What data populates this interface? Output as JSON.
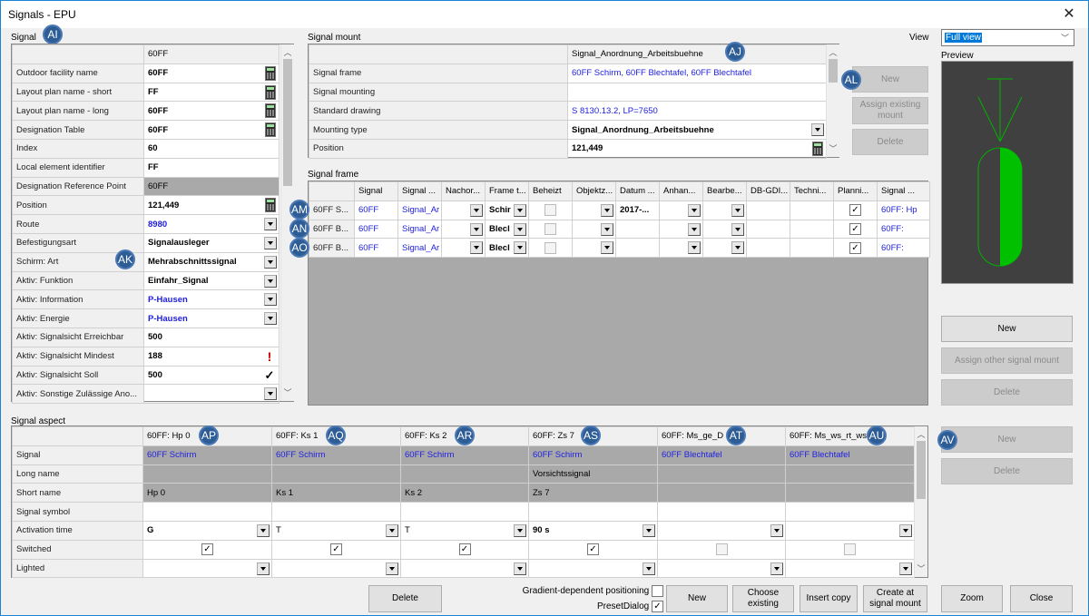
{
  "window": {
    "title": "Signals - EPU",
    "close_label": "✕"
  },
  "signal": {
    "section_label": "Signal",
    "column_header": "60FF",
    "rows": [
      {
        "label": "Outdoor facility name",
        "value": "60FF",
        "style": "bold",
        "control": "calc"
      },
      {
        "label": "Layout plan name - short",
        "value": "FF",
        "style": "bold",
        "control": "calc"
      },
      {
        "label": "Layout plan name - long",
        "value": "60FF",
        "style": "bold",
        "control": "calc"
      },
      {
        "label": "Designation Table",
        "value": "60FF",
        "style": "bold",
        "control": "calc"
      },
      {
        "label": "Index",
        "value": "60",
        "style": "bold",
        "control": ""
      },
      {
        "label": "Local element identifier",
        "value": "FF",
        "style": "bold",
        "control": ""
      },
      {
        "label": "Designation Reference Point",
        "value": "60FF",
        "style": "gray",
        "control": ""
      },
      {
        "label": "Position",
        "value": "121,449",
        "style": "bold",
        "control": "calc"
      },
      {
        "label": "Route",
        "value": "8980",
        "style": "blue",
        "control": "dropdown"
      },
      {
        "label": "Befestigungsart",
        "value": "Signalausleger",
        "style": "bold",
        "control": "dropdown"
      },
      {
        "label": "Schirm: Art",
        "value": "Mehrabschnittssignal",
        "style": "bold",
        "control": "dropdown"
      },
      {
        "label": "Aktiv: Funktion",
        "value": "Einfahr_Signal",
        "style": "bold",
        "control": "dropdown"
      },
      {
        "label": "Aktiv: Information",
        "value": "P-Hausen",
        "style": "blue",
        "control": "dropdown"
      },
      {
        "label": "Aktiv: Energie",
        "value": "P-Hausen",
        "style": "blue",
        "control": "dropdown"
      },
      {
        "label": "Aktiv: Signalsicht Erreichbar",
        "value": "500",
        "style": "bold",
        "control": ""
      },
      {
        "label": "Aktiv: Signalsicht Mindest",
        "value": "188",
        "style": "bold",
        "control": "warning"
      },
      {
        "label": "Aktiv: Signalsicht Soll",
        "value": "500",
        "style": "bold",
        "control": "check"
      },
      {
        "label": "Aktiv: Sonstige Zulässige Ano...",
        "value": "",
        "style": "bold",
        "control": "dropdown"
      }
    ]
  },
  "signal_mount": {
    "section_label": "Signal mount",
    "column_header": "Signal_Anordnung_Arbeitsbuehne",
    "rows": [
      {
        "label": "Signal frame",
        "value": "60FF Schirm, 60FF Blechtafel, 60FF Blechtafel",
        "style": "blue",
        "control": ""
      },
      {
        "label": "Signal mounting",
        "value": "",
        "style": "",
        "control": ""
      },
      {
        "label": "Standard drawing",
        "value": "S 8130.13.2, LP=7650",
        "style": "blue",
        "control": ""
      },
      {
        "label": "Mounting type",
        "value": "Signal_Anordnung_Arbeitsbuehne",
        "style": "bold",
        "control": "dropdown"
      },
      {
        "label": "Position",
        "value": "121,449",
        "style": "bold",
        "control": "calc"
      }
    ],
    "buttons": {
      "new": "New",
      "assign_existing": "Assign existing mount",
      "delete": "Delete"
    }
  },
  "signal_frame": {
    "section_label": "Signal frame",
    "columns": [
      "",
      "Signal",
      "Signal ...",
      "Nachor...",
      "Frame t...",
      "Beheizt",
      "Objektz...",
      "Datum ...",
      "Anhan...",
      "Bearbe...",
      "DB-GDI...",
      "Techni...",
      "Planni...",
      "Signal ..."
    ],
    "rows": [
      {
        "name": "60FF S...",
        "signal": "60FF",
        "signal_mount": "Signal_Ar",
        "nachor": "",
        "frame_type": "Schir",
        "beheizt": false,
        "objektz": "",
        "datum": "2017-...",
        "anhan": "",
        "bearbe": "",
        "db_gdi": "",
        "techni": "",
        "planning": true,
        "signal_aspect": "60FF: Hp"
      },
      {
        "name": "60FF B...",
        "signal": "60FF",
        "signal_mount": "Signal_Ar",
        "nachor": "",
        "frame_type": "Blecl",
        "beheizt": false,
        "objektz": "",
        "datum": "",
        "anhan": "",
        "bearbe": "",
        "db_gdi": "",
        "techni": "",
        "planning": true,
        "signal_aspect": "60FF:"
      },
      {
        "name": "60FF B...",
        "signal": "60FF",
        "signal_mount": "Signal_Ar",
        "nachor": "",
        "frame_type": "Blecl",
        "beheizt": false,
        "objektz": "",
        "datum": "",
        "anhan": "",
        "bearbe": "",
        "db_gdi": "",
        "techni": "",
        "planning": true,
        "signal_aspect": "60FF:"
      }
    ]
  },
  "view": {
    "label": "View",
    "selected": "Full view",
    "preview_label": "Preview"
  },
  "frame_buttons": {
    "new": "New",
    "assign_other": "Assign other signal mount",
    "delete": "Delete"
  },
  "signal_aspect": {
    "section_label": "Signal aspect",
    "row_labels": [
      "Signal",
      "Long name",
      "Short name",
      "Signal symbol",
      "Activation time",
      "Switched",
      "Lighted"
    ],
    "columns": [
      {
        "header": "60FF: Hp 0",
        "signal": "60FF Schirm",
        "long_name": "",
        "short_name": "Hp 0",
        "symbol": "",
        "activation": "G",
        "activation_bold": true,
        "switched": true,
        "switched_enabled": true,
        "lighted": ""
      },
      {
        "header": "60FF: Ks 1",
        "signal": "60FF Schirm",
        "long_name": "",
        "short_name": "Ks 1",
        "symbol": "",
        "activation": "T",
        "activation_bold": false,
        "switched": true,
        "switched_enabled": true,
        "lighted": ""
      },
      {
        "header": "60FF: Ks 2",
        "signal": "60FF Schirm",
        "long_name": "",
        "short_name": "Ks 2",
        "symbol": "",
        "activation": "T",
        "activation_bold": false,
        "switched": true,
        "switched_enabled": true,
        "lighted": ""
      },
      {
        "header": "60FF: Zs 7",
        "signal": "60FF Schirm",
        "long_name": "Vorsichtssignal",
        "short_name": "Zs 7",
        "symbol": "",
        "activation": "90 s",
        "activation_bold": true,
        "switched": true,
        "switched_enabled": true,
        "lighted": ""
      },
      {
        "header": "60FF: Ms_ge_D",
        "signal": "60FF Blechtafel",
        "long_name": "",
        "short_name": "",
        "symbol": "",
        "activation": "",
        "activation_bold": false,
        "switched": false,
        "switched_enabled": false,
        "lighted": ""
      },
      {
        "header": "60FF: Ms_ws_rt_ws",
        "signal": "60FF Blechtafel",
        "long_name": "",
        "short_name": "",
        "symbol": "",
        "activation": "",
        "activation_bold": false,
        "switched": false,
        "switched_enabled": false,
        "lighted": ""
      }
    ],
    "buttons": {
      "new": "New",
      "delete": "Delete"
    }
  },
  "bottom": {
    "delete": "Delete",
    "gradient_label": "Gradient-dependent positioning",
    "gradient_checked": false,
    "preset_label": "PresetDialog",
    "preset_checked": true,
    "new": "New",
    "choose_existing": "Choose existing",
    "insert_copy": "Insert copy",
    "create_at_mount": "Create at signal mount",
    "zoom": "Zoom",
    "close": "Close"
  },
  "annotations": {
    "AI": "AI",
    "AJ": "AJ",
    "AK": "AK",
    "AL": "AL",
    "AM": "AM",
    "AN": "AN",
    "AO": "AO",
    "AP": "AP",
    "AQ": "AQ",
    "AR": "AR",
    "AS": "AS",
    "AT": "AT",
    "AU": "AU",
    "AV": "AV"
  },
  "colors": {
    "link_blue": "#2020e0",
    "disabled_gray": "#a9a9a9",
    "preview_bg": "#404040",
    "signal_green": "#00c000",
    "accent": "#1883d7"
  }
}
